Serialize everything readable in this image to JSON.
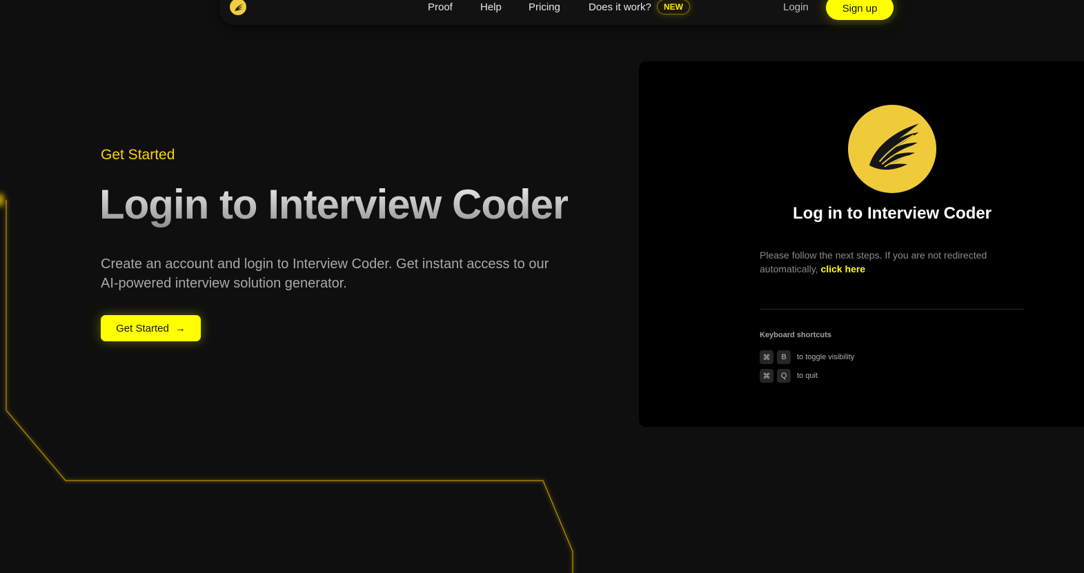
{
  "nav": {
    "logo_icon": "wing-logo-icon",
    "links": [
      {
        "label": "Proof"
      },
      {
        "label": "Help"
      },
      {
        "label": "Pricing"
      },
      {
        "label": "Does it work?"
      }
    ],
    "badge": "NEW",
    "login_label": "Login",
    "signup_label": "Sign up"
  },
  "hero": {
    "eyebrow": "Get Started",
    "title": "Login to Interview Coder",
    "subtitle": "Create an account and login to Interview Coder. Get instant access to our AI-powered interview solution generator.",
    "cta_label": "Get Started",
    "cta_icon": "arrow-right-icon"
  },
  "card": {
    "logo_icon": "wing-logo-icon",
    "title": "Log in to Interview Coder",
    "message": "Please follow the next steps. If you are not redirected automatically,",
    "link_label": "click here",
    "shortcuts_title": "Keyboard shortcuts",
    "shortcuts": [
      {
        "mod": "⌘",
        "key": "B",
        "description": "to toggle visibility"
      },
      {
        "mod": "⌘",
        "key": "Q",
        "description": "to quit"
      }
    ]
  },
  "colors": {
    "accent": "#ffff00",
    "eyebrow": "#ffd400",
    "background": "#0f0f0f",
    "card": "#000000",
    "logo": "#efcb3c"
  }
}
